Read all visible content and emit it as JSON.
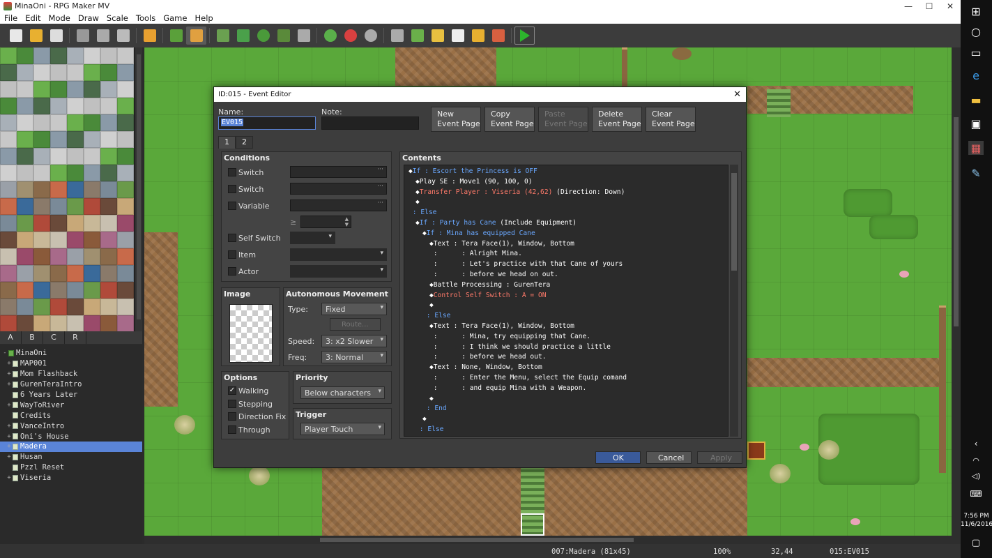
{
  "window": {
    "title": "MinaOni - RPG Maker MV",
    "min": "—",
    "max": "☐",
    "close": "✕"
  },
  "menu": [
    "File",
    "Edit",
    "Mode",
    "Draw",
    "Scale",
    "Tools",
    "Game",
    "Help"
  ],
  "toolbar_icons": [
    "new-project-icon",
    "open-project-icon",
    "save-project-icon",
    "cut-icon",
    "copy-icon",
    "paste-icon",
    "undo-icon",
    "map-mode-icon",
    "event-mode-icon",
    "pencil-icon",
    "rectangle-icon",
    "ellipse-icon",
    "flood-fill-icon",
    "shadow-pen-icon",
    "zoom-in-icon",
    "zoom-out-icon",
    "actual-size-icon",
    "database-icon",
    "plugin-manager-icon",
    "sound-test-icon",
    "event-searcher-icon",
    "resource-manager-icon",
    "character-generator-icon",
    "playtest-icon"
  ],
  "tile_tabs": [
    "A",
    "B",
    "C",
    "R"
  ],
  "map_tree": [
    {
      "label": "MinaOni",
      "level": 0,
      "exp": "-",
      "root": true
    },
    {
      "label": "MAP001",
      "level": 1,
      "exp": "+"
    },
    {
      "label": "Mom Flashback",
      "level": 1,
      "exp": "+"
    },
    {
      "label": "GurenTeraIntro",
      "level": 1,
      "exp": "+"
    },
    {
      "label": "6 Years Later",
      "level": 1,
      "exp": ""
    },
    {
      "label": "WayToRiver",
      "level": 1,
      "exp": "+"
    },
    {
      "label": "Credits",
      "level": 1,
      "exp": ""
    },
    {
      "label": "VanceIntro",
      "level": 1,
      "exp": "+"
    },
    {
      "label": "Oni's House",
      "level": 1,
      "exp": "+"
    },
    {
      "label": "Madera",
      "level": 1,
      "exp": "+",
      "selected": true
    },
    {
      "label": "Husan",
      "level": 1,
      "exp": "+"
    },
    {
      "label": "Pzzl Reset",
      "level": 1,
      "exp": ""
    },
    {
      "label": "Viseria",
      "level": 1,
      "exp": "+"
    }
  ],
  "status": {
    "map": "007:Madera (81x45)",
    "zoom": "100%",
    "coords": "32,44",
    "event": "015:EV015"
  },
  "taskbar": {
    "time": "7:56 PM",
    "date": "11/6/2016"
  },
  "dialog": {
    "title": "ID:015 - Event Editor",
    "close": "✕",
    "name_label": "Name:",
    "name_value": "EV015",
    "note_label": "Note:",
    "note_value": "",
    "page_buttons": [
      {
        "line1": "New",
        "line2": "Event Page",
        "enabled": true
      },
      {
        "line1": "Copy",
        "line2": "Event Page",
        "enabled": true
      },
      {
        "line1": "Paste",
        "line2": "Event Page",
        "enabled": false
      },
      {
        "line1": "Delete",
        "line2": "Event Page",
        "enabled": true
      },
      {
        "line1": "Clear",
        "line2": "Event Page",
        "enabled": true
      }
    ],
    "tabs": [
      "1",
      "2"
    ],
    "conditions": {
      "header": "Conditions",
      "switch1": "Switch",
      "switch2": "Switch",
      "variable": "Variable",
      "ge": "≥",
      "self_switch": "Self Switch",
      "item": "Item",
      "actor": "Actor"
    },
    "image": {
      "header": "Image"
    },
    "autonomous": {
      "header": "Autonomous Movement",
      "type_label": "Type:",
      "type_value": "Fixed",
      "route": "Route...",
      "speed_label": "Speed:",
      "speed_value": "3: x2 Slower",
      "freq_label": "Freq:",
      "freq_value": "3: Normal"
    },
    "options": {
      "header": "Options",
      "walking": "Walking",
      "stepping": "Stepping",
      "direction_fix": "Direction Fix",
      "through": "Through",
      "walking_checked": "✓"
    },
    "priority": {
      "header": "Priority",
      "value": "Below characters"
    },
    "trigger": {
      "header": "Trigger",
      "value": "Player Touch"
    },
    "contents_header": "Contents",
    "commands": [
      {
        "indent": 0,
        "parts": [
          [
            "k",
            "◆"
          ],
          [
            "b",
            "If : Escort the Princess is OFF"
          ]
        ]
      },
      {
        "indent": 1,
        "parts": [
          [
            "k",
            "◆Play SE : Move1 (90, 100, 0)"
          ]
        ]
      },
      {
        "indent": 1,
        "parts": [
          [
            "k",
            "◆"
          ],
          [
            "r",
            "Transfer Player : Viseria (42,62)"
          ],
          [
            "k",
            " (Direction: Down)"
          ]
        ]
      },
      {
        "indent": 1,
        "parts": [
          [
            "k",
            "◆"
          ]
        ]
      },
      {
        "indent": 0,
        "parts": [
          [
            "b",
            " : Else"
          ]
        ]
      },
      {
        "indent": 1,
        "parts": [
          [
            "k",
            "◆"
          ],
          [
            "b",
            "If : Party has Cane"
          ],
          [
            "k",
            " (Include Equipment)"
          ]
        ]
      },
      {
        "indent": 2,
        "parts": [
          [
            "k",
            "◆"
          ],
          [
            "b",
            "If : Mina has equipped Cane"
          ]
        ]
      },
      {
        "indent": 3,
        "parts": [
          [
            "k",
            "◆Text"
          ],
          [
            "k",
            " : Tera Face(1), Window, Bottom"
          ]
        ]
      },
      {
        "indent": 3,
        "parts": [
          [
            "k",
            " :      : Alright Mina."
          ]
        ]
      },
      {
        "indent": 3,
        "parts": [
          [
            "k",
            " :      : Let's practice with that Cane of yours"
          ]
        ]
      },
      {
        "indent": 3,
        "parts": [
          [
            "k",
            " :      : before we head on out."
          ]
        ]
      },
      {
        "indent": 3,
        "parts": [
          [
            "k",
            "◆Battle Processing : GurenTera"
          ]
        ]
      },
      {
        "indent": 3,
        "parts": [
          [
            "k",
            "◆"
          ],
          [
            "r",
            "Control Self Switch : A = ON"
          ]
        ]
      },
      {
        "indent": 3,
        "parts": [
          [
            "k",
            "◆"
          ]
        ]
      },
      {
        "indent": 2,
        "parts": [
          [
            "b",
            " : Else"
          ]
        ]
      },
      {
        "indent": 3,
        "parts": [
          [
            "k",
            "◆Text : Tera Face(1), Window, Bottom"
          ]
        ]
      },
      {
        "indent": 3,
        "parts": [
          [
            "k",
            " :      : Mina, try equipping that Cane."
          ]
        ]
      },
      {
        "indent": 3,
        "parts": [
          [
            "k",
            " :      : I think we should practice a little"
          ]
        ]
      },
      {
        "indent": 3,
        "parts": [
          [
            "k",
            " :      : before we head out."
          ]
        ]
      },
      {
        "indent": 3,
        "parts": [
          [
            "k",
            "◆Text : None, Window, Bottom"
          ]
        ]
      },
      {
        "indent": 3,
        "parts": [
          [
            "k",
            " :      : Enter the Menu, select the Equip comand"
          ]
        ]
      },
      {
        "indent": 3,
        "parts": [
          [
            "k",
            " :      : and equip Mina with a Weapon."
          ]
        ]
      },
      {
        "indent": 3,
        "parts": [
          [
            "k",
            "◆"
          ]
        ]
      },
      {
        "indent": 2,
        "parts": [
          [
            "b",
            " : End"
          ]
        ]
      },
      {
        "indent": 2,
        "parts": [
          [
            "k",
            "◆"
          ]
        ]
      },
      {
        "indent": 1,
        "parts": [
          [
            "b",
            " : Else"
          ]
        ]
      }
    ],
    "ok": "OK",
    "cancel": "Cancel",
    "apply": "Apply"
  },
  "colors": {
    "accent_selected": "#5a84d8",
    "if_blue": "#6aa8ff",
    "transfer_red": "#ff7a6a",
    "playtest_green": "#2db52d"
  }
}
